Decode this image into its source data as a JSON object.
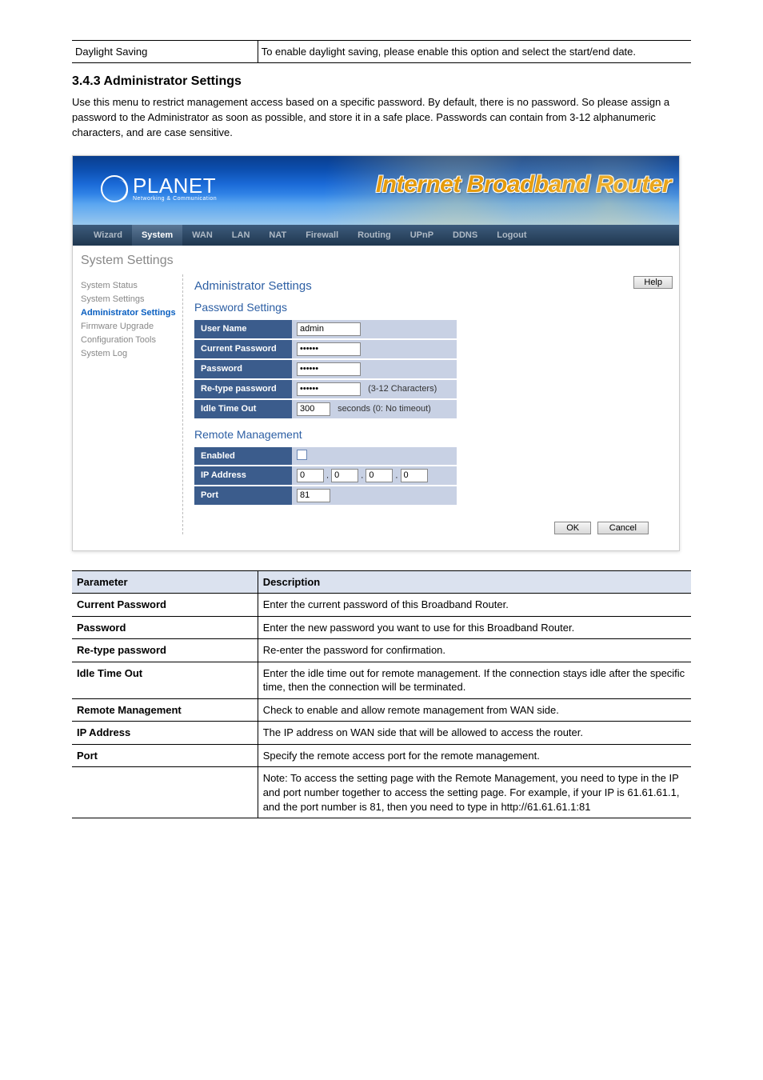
{
  "top_row": {
    "left": "Daylight Saving",
    "right": "To enable daylight saving, please enable this option and select the start/end date."
  },
  "section": {
    "title": "3.4.3 Administrator Settings",
    "text": "Use this menu to restrict management access based on a specific password. By default, there is no password. So please assign a password to the Administrator as soon as possible, and store it in a safe place. Passwords can contain from 3-12 alphanumeric characters, and are case sensitive."
  },
  "nav": [
    "Wizard",
    "System",
    "WAN",
    "LAN",
    "NAT",
    "Firewall",
    "Routing",
    "UPnP",
    "DDNS",
    "Logout"
  ],
  "nav_active": "System",
  "page_sub": "System Settings",
  "sidebar": [
    "System Status",
    "System Settings",
    "Administrator Settings",
    "Firmware Upgrade",
    "Configuration Tools",
    "System Log"
  ],
  "sidebar_active": "Administrator Settings",
  "logo": {
    "name": "PLANET",
    "sub": "Networking & Communication"
  },
  "banner_title": "Internet Broadband Router",
  "main": {
    "title": "Administrator Settings",
    "help": "Help",
    "sub1": "Password Settings",
    "rows1": {
      "user_lbl": "User Name",
      "user_val": "admin",
      "cur_lbl": "Current Password",
      "cur_val": "••••••",
      "pw_lbl": "Password",
      "pw_val": "••••••",
      "re_lbl": "Re-type password",
      "re_val": "••••••",
      "re_hint": "(3-12 Characters)",
      "idle_lbl": "Idle Time Out",
      "idle_val": "300",
      "idle_hint": "seconds (0: No timeout)"
    },
    "sub2": "Remote Management",
    "rows2": {
      "en_lbl": "Enabled",
      "ip_lbl": "IP Address",
      "ip": [
        "0",
        "0",
        "0",
        "0"
      ],
      "port_lbl": "Port",
      "port_val": "81"
    },
    "ok": "OK",
    "cancel": "Cancel"
  },
  "desc": {
    "head_l": "Parameter",
    "head_r": "Description",
    "rows": [
      [
        "Current Password",
        "Enter the current password of this Broadband Router."
      ],
      [
        "Password",
        "Enter the new password you want to use for this Broadband Router."
      ],
      [
        "Re-type password",
        "Re-enter the password for confirmation."
      ],
      [
        "Idle Time Out",
        "Enter the idle time out for remote management. If the connection stays idle after the specific time, then the connection will be terminated."
      ],
      [
        "Remote Management",
        "Check to enable and allow remote management from WAN side."
      ],
      [
        "IP Address",
        "The IP address on WAN side that will be allowed to access the router."
      ],
      [
        "Port",
        "Specify the remote access port for the remote management."
      ],
      [
        "",
        "Note: To access the setting page with the Remote Management, you need to type in the IP and port number together to access the setting page. For example, if your IP is 61.61.61.1, and the port number is 81, then you need to type in http://61.61.61.1:81"
      ]
    ]
  }
}
